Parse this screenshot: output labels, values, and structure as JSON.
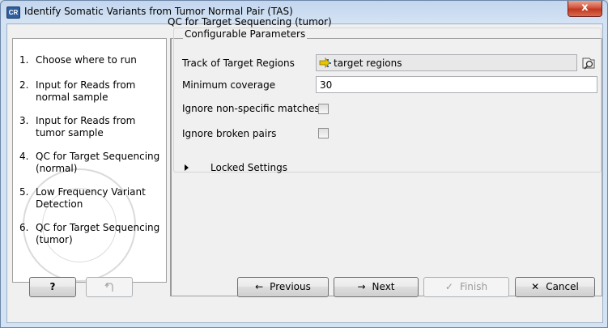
{
  "window": {
    "app_icon": "CR",
    "title": "Identify Somatic Variants from Tumor Normal Pair (TAS)",
    "close_glyph": "x"
  },
  "steps": [
    {
      "num": "1.",
      "label": "Choose where to run"
    },
    {
      "num": "2.",
      "label": "Input for Reads from normal sample"
    },
    {
      "num": "3.",
      "label": "Input for Reads from tumor sample"
    },
    {
      "num": "4.",
      "label": "QC for Target Sequencing (normal)"
    },
    {
      "num": "5.",
      "label": "Low Frequency Variant Detection"
    },
    {
      "num": "6.",
      "label": "QC for Target Sequencing (tumor)"
    }
  ],
  "main": {
    "section_title": "QC for Target Sequencing (tumor)",
    "group_title": "Configurable Parameters",
    "track_label": "Track of Target Regions",
    "track_value": "target regions",
    "min_cov_label": "Minimum coverage",
    "min_cov_value": "30",
    "ignore_nonspecific_label": "Ignore non-specific matches",
    "ignore_nonspecific_checked": false,
    "ignore_broken_label": "Ignore broken pairs",
    "ignore_broken_checked": false,
    "locked_settings_label": "Locked Settings"
  },
  "buttons": {
    "help": "?",
    "previous": "Previous",
    "next": "Next",
    "finish": "Finish",
    "cancel": "Cancel"
  },
  "icons": {
    "track": "track-icon",
    "browse": "browse-icon",
    "undo": "undo-icon",
    "previous": "arrow-left-icon",
    "next": "arrow-right-icon",
    "finish": "checkmark-icon",
    "cancel": "x-icon"
  }
}
